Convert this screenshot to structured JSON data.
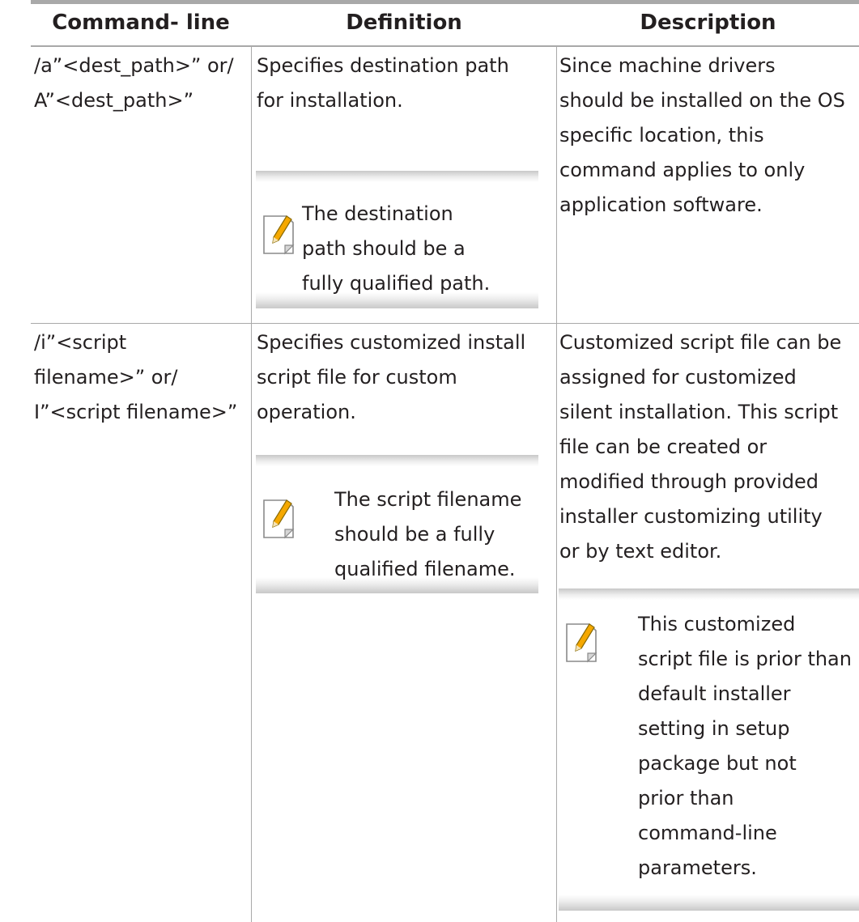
{
  "table": {
    "headers": [
      "Command- line",
      "Definition",
      "Description"
    ],
    "rows": [
      {
        "command": "/a”<dest_path>” or/\nA”<dest_path>”",
        "definition": "Specifies destination path\nfor installation.",
        "definition_note": "The destination\npath should be a\nfully qualified path.",
        "description": "Since machine drivers\nshould be installed on the OS\nspecific location, this\ncommand applies to only\napplication software."
      },
      {
        "command": "/i”<script\nfilename>” or/\nI”<script filename>”",
        "definition": "Specifies customized install\nscript file for custom\noperation.",
        "definition_note": "The script filename\nshould be a fully\nqualified filename.",
        "description": "Customized script file can be\nassigned for customized\nsilent installation. This script\nfile can be created or\nmodified through provided\ninstaller customizing utility\nor by text editor.",
        "description_note": "This customized\nscript file is prior than\ndefault installer\nsetting in setup\npackage but not\nprior than\ncommand-line\nparameters."
      }
    ]
  },
  "note_icon": "note-pencil-icon",
  "colors": {
    "rule": "#a9a9a9",
    "text": "#231f20",
    "pencil": "#f5a800"
  }
}
